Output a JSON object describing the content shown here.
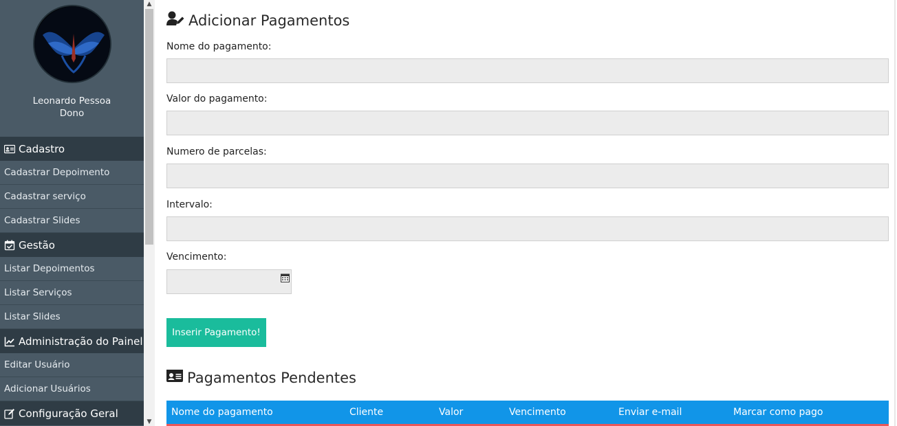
{
  "profile": {
    "name": "Leonardo Pessoa",
    "role": "Dono"
  },
  "sidebar": {
    "sections": [
      {
        "title": "Cadastro",
        "icon": "id-card-icon",
        "items": [
          "Cadastrar Depoimento",
          "Cadastrar serviço",
          "Cadastrar Slides"
        ]
      },
      {
        "title": "Gestão",
        "icon": "calendar-check-icon",
        "items": [
          "Listar Depoimentos",
          "Listar Serviços",
          "Listar Slides"
        ]
      },
      {
        "title": "Administração do Painel",
        "icon": "chart-line-icon",
        "items": [
          "Editar Usuário",
          "Adicionar Usuários"
        ]
      },
      {
        "title": "Configuração Geral",
        "icon": "edit-icon",
        "items": []
      }
    ]
  },
  "form": {
    "title": "Adicionar Pagamentos",
    "title_icon": "user-edit-icon",
    "fields": {
      "nome": {
        "label": "Nome do pagamento:",
        "value": ""
      },
      "valor": {
        "label": "Valor do pagamento:",
        "value": ""
      },
      "parcelas": {
        "label": "Numero de parcelas:",
        "value": ""
      },
      "intervalo": {
        "label": "Intervalo:",
        "value": ""
      },
      "vencimento": {
        "label": "Vencimento:",
        "value": ""
      }
    },
    "submit_label": "Inserir Pagamento!"
  },
  "pending": {
    "title": "Pagamentos Pendentes",
    "title_icon": "id-card-icon",
    "columns": [
      "Nome do pagamento",
      "Cliente",
      "Valor",
      "Vencimento",
      "Enviar e-mail",
      "Marcar como pago"
    ]
  },
  "colors": {
    "sidebar_bg": "#4a5a66",
    "section_header_bg": "#2f3c45",
    "submit_bg": "#1abc9c",
    "table_header_bg": "#1195e8",
    "table_row_accent": "#e8585a"
  }
}
